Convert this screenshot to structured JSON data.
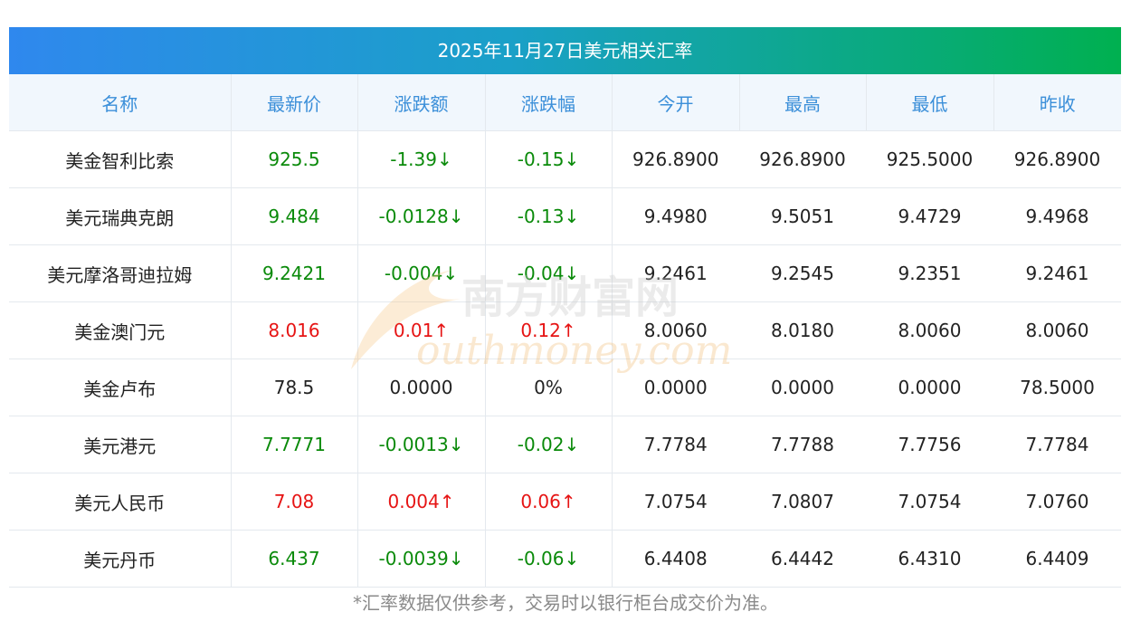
{
  "title": "2025年11月27日美元相关汇率",
  "headers": [
    "名称",
    "最新价",
    "涨跌额",
    "涨跌幅",
    "今开",
    "最高",
    "最低",
    "昨收"
  ],
  "rows": [
    {
      "name": "美金智利比索",
      "latest": "925.5",
      "change": "-1.39↓",
      "pct": "-0.15↓",
      "open": "926.8900",
      "high": "926.8900",
      "low": "925.5000",
      "prev": "926.8900",
      "trend": "down"
    },
    {
      "name": "美元瑞典克朗",
      "latest": "9.484",
      "change": "-0.0128↓",
      "pct": "-0.13↓",
      "open": "9.4980",
      "high": "9.5051",
      "low": "9.4729",
      "prev": "9.4968",
      "trend": "down"
    },
    {
      "name": "美元摩洛哥迪拉姆",
      "latest": "9.2421",
      "change": "-0.004↓",
      "pct": "-0.04↓",
      "open": "9.2461",
      "high": "9.2545",
      "low": "9.2351",
      "prev": "9.2461",
      "trend": "down"
    },
    {
      "name": "美金澳门元",
      "latest": "8.016",
      "change": "0.01↑",
      "pct": "0.12↑",
      "open": "8.0060",
      "high": "8.0180",
      "low": "8.0060",
      "prev": "8.0060",
      "trend": "up"
    },
    {
      "name": "美金卢布",
      "latest": "78.5",
      "change": "0.0000",
      "pct": "0%",
      "open": "0.0000",
      "high": "0.0000",
      "low": "0.0000",
      "prev": "78.5000",
      "trend": "flat"
    },
    {
      "name": "美元港元",
      "latest": "7.7771",
      "change": "-0.0013↓",
      "pct": "-0.02↓",
      "open": "7.7784",
      "high": "7.7788",
      "low": "7.7756",
      "prev": "7.7784",
      "trend": "down"
    },
    {
      "name": "美元人民币",
      "latest": "7.08",
      "change": "0.004↑",
      "pct": "0.06↑",
      "open": "7.0754",
      "high": "7.0807",
      "low": "7.0754",
      "prev": "7.0760",
      "trend": "up"
    },
    {
      "name": "美元丹币",
      "latest": "6.437",
      "change": "-0.0039↓",
      "pct": "-0.06↓",
      "open": "6.4408",
      "high": "6.4442",
      "low": "6.4310",
      "prev": "6.4409",
      "trend": "down"
    }
  ],
  "footnote": "*汇率数据仅供参考，交易时以银行柜台成交价为准。",
  "watermark": {
    "cn": "南方财富网",
    "en": "outhmoney.com"
  },
  "colors": {
    "up": "#e61414",
    "down": "#0a8a0a",
    "header_text": "#3b8fd9",
    "header_bg": "#f1f7fd"
  }
}
